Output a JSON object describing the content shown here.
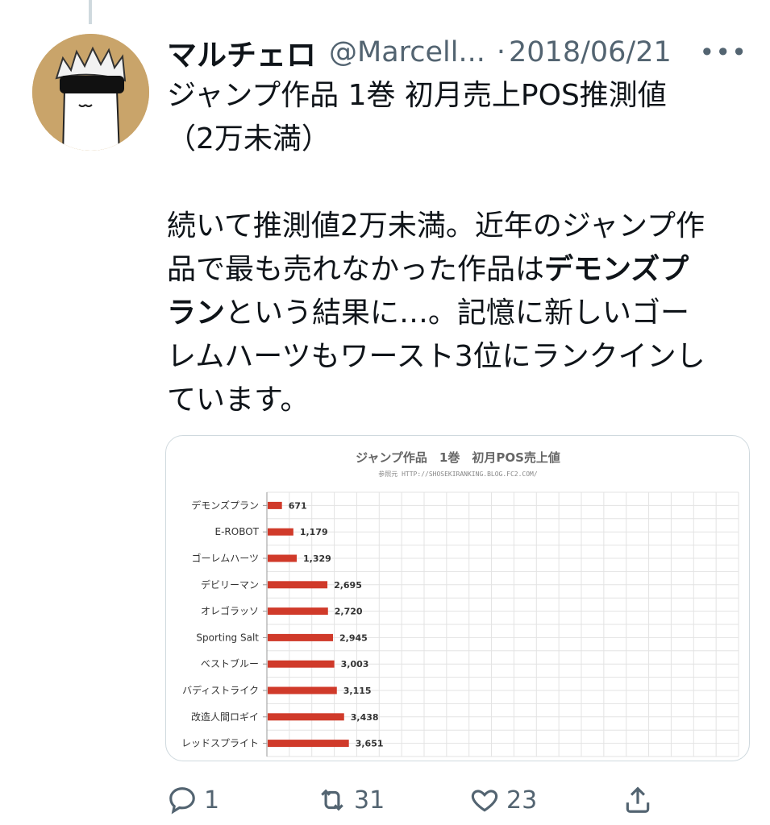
{
  "tweet": {
    "display_name": "マルチェロ",
    "handle": "@Marcell...",
    "separator": "·",
    "date": "2018/06/21",
    "more_icon": "more-dots-icon",
    "title_lines": [
      "ジャンプ作品 1巻 初月売上POS推測値",
      "（2万未満）"
    ],
    "body": {
      "line1": "続いて推測値2万未満。近年のジャンプ作",
      "line2_a": "品で最も売れなかった作品は",
      "line2_b": "デモンズプ",
      "line3_a": "ラン",
      "line3_b": "という結果に…。記憶に新しいゴー",
      "line4": "レムハーツもワースト3位にランクインし",
      "line5": "ています。"
    }
  },
  "chart_data": {
    "type": "bar",
    "orientation": "horizontal",
    "title": "ジャンプ作品　1巻　初月POS売上値",
    "subtitle": "参照元 HTTP://SHOSEKIRANKING.BLOG.FC2.COM/",
    "categories": [
      "デモンズプラン",
      "E-ROBOT",
      "ゴーレムハーツ",
      "デビリーマン",
      "オレゴラッソ",
      "Sporting Salt",
      "ベストブルー",
      "バディストライク",
      "改造人間ロギイ",
      "レッドスプライト"
    ],
    "values": [
      671,
      1179,
      1329,
      2695,
      2720,
      2945,
      3003,
      3115,
      3438,
      3651
    ],
    "value_labels": [
      "671",
      "1,179",
      "1,329",
      "2,695",
      "2,720",
      "2,945",
      "3,003",
      "3,115",
      "3,438",
      "3,651"
    ],
    "xlim": [
      0,
      21000
    ],
    "grid": true,
    "bar_color": "#d03a2a"
  },
  "actions": {
    "reply": {
      "icon": "reply-icon",
      "count": "1"
    },
    "retweet": {
      "icon": "retweet-icon",
      "count": "31"
    },
    "like": {
      "icon": "heart-icon",
      "count": "23"
    },
    "share": {
      "icon": "share-icon"
    }
  },
  "colors": {
    "text": "#0f1419",
    "muted": "#536471",
    "border": "#cfd9de",
    "avatar_bg": "#c9a46a"
  }
}
